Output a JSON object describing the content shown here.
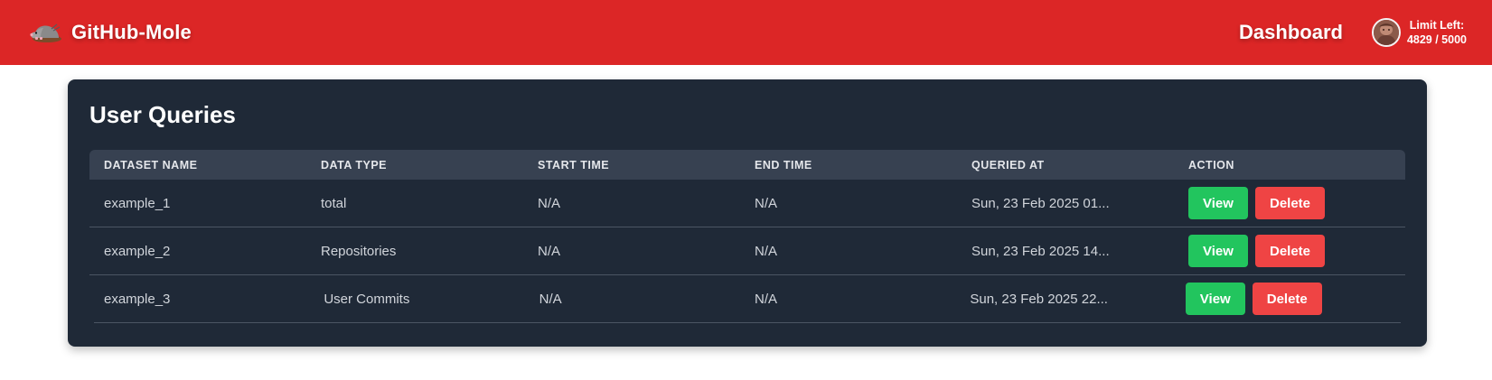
{
  "colors": {
    "navbar": "#dc2626",
    "card": "#1f2937",
    "table_header": "#374151",
    "view_button": "#22c55e",
    "delete_button": "#ef4444"
  },
  "navbar": {
    "logo_icon": "mole-icon",
    "brand": "GitHub-Mole",
    "dashboard_link": "Dashboard",
    "avatar_icon": "user-avatar",
    "limit_label": "Limit Left:",
    "limit_value": "4829 / 5000"
  },
  "card": {
    "title": "User Queries"
  },
  "table": {
    "headers": [
      "DATASET NAME",
      "DATA TYPE",
      "START TIME",
      "END TIME",
      "QUERIED AT",
      "ACTION"
    ],
    "rows": [
      {
        "dataset_name": "example_1",
        "data_type": "total",
        "start_time": "N/A",
        "end_time": "N/A",
        "queried_at": "Sun, 23 Feb 2025 01..."
      },
      {
        "dataset_name": "example_2",
        "data_type": "Repositories",
        "start_time": "N/A",
        "end_time": "N/A",
        "queried_at": "Sun, 23 Feb 2025 14..."
      },
      {
        "dataset_name": "example_3",
        "data_type": "User Commits",
        "start_time": "N/A",
        "end_time": "N/A",
        "queried_at": "Sun, 23 Feb 2025 22..."
      }
    ],
    "view_label": "View",
    "delete_label": "Delete"
  }
}
